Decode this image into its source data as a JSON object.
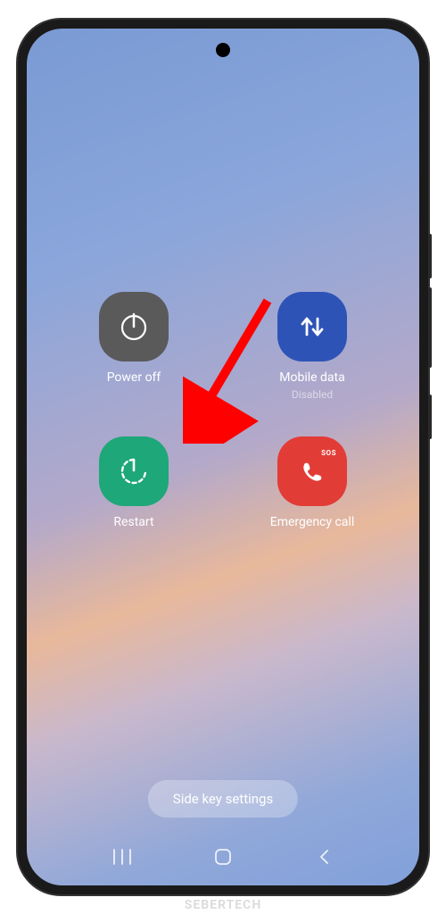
{
  "power_menu": {
    "power_off": {
      "label": "Power off"
    },
    "mobile_data": {
      "label": "Mobile data",
      "sublabel": "Disabled"
    },
    "restart": {
      "label": "Restart"
    },
    "emergency": {
      "label": "Emergency call",
      "badge": "SOS"
    }
  },
  "bottom_button": {
    "label": "Side key settings"
  },
  "watermark": "SEBERTECH",
  "colors": {
    "gray": "#5a5a5a",
    "blue": "#2e53b7",
    "green": "#1ea778",
    "red": "#e23c36",
    "arrow": "#ff0000"
  }
}
